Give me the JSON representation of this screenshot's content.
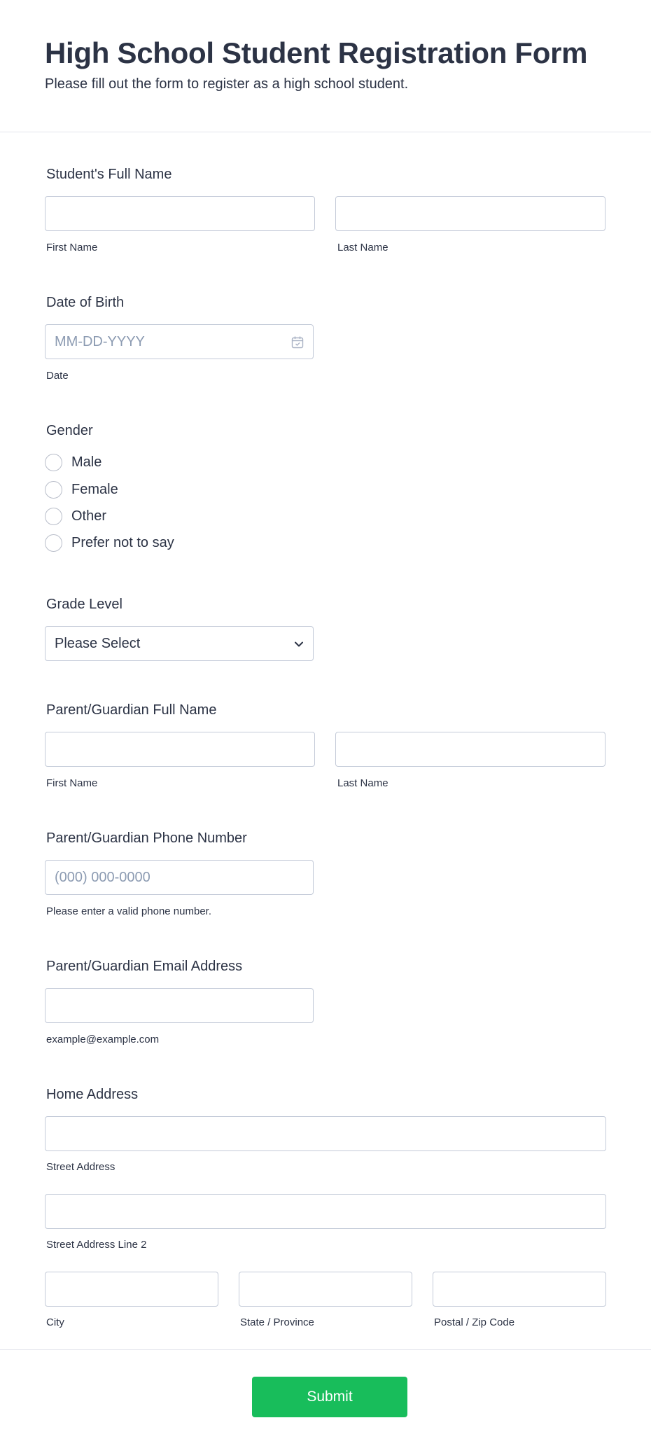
{
  "header": {
    "title": "High School Student Registration Form",
    "subtitle": "Please fill out the form to register as a high school student."
  },
  "student_name": {
    "label": "Student's Full Name",
    "first_sublabel": "First Name",
    "last_sublabel": "Last Name",
    "first_value": "",
    "last_value": ""
  },
  "date_of_birth": {
    "label": "Date of Birth",
    "placeholder": "MM-DD-YYYY",
    "sublabel": "Date",
    "icon": "calendar-icon"
  },
  "gender": {
    "label": "Gender",
    "options": [
      "Male",
      "Female",
      "Other",
      "Prefer not to say"
    ],
    "selected": null
  },
  "grade_level": {
    "label": "Grade Level",
    "selected": "Please Select",
    "icon": "chevron-down-icon"
  },
  "guardian_name": {
    "label": "Parent/Guardian Full Name",
    "first_sublabel": "First Name",
    "last_sublabel": "Last Name",
    "first_value": "",
    "last_value": ""
  },
  "guardian_phone": {
    "label": "Parent/Guardian Phone Number",
    "placeholder": "(000) 000-0000",
    "sublabel": "Please enter a valid phone number."
  },
  "guardian_email": {
    "label": "Parent/Guardian Email Address",
    "sublabel": "example@example.com",
    "value": ""
  },
  "home_address": {
    "label": "Home Address",
    "street_sublabel": "Street Address",
    "street2_sublabel": "Street Address Line 2",
    "city_sublabel": "City",
    "state_sublabel": "State / Province",
    "zip_sublabel": "Postal / Zip Code"
  },
  "footer": {
    "submit_label": "Submit"
  },
  "colors": {
    "text": "#2c3345",
    "border": "#c3cad8",
    "placeholder": "#8c9bb2",
    "submit": "#18bd5b",
    "divider": "#e3e5ec"
  }
}
